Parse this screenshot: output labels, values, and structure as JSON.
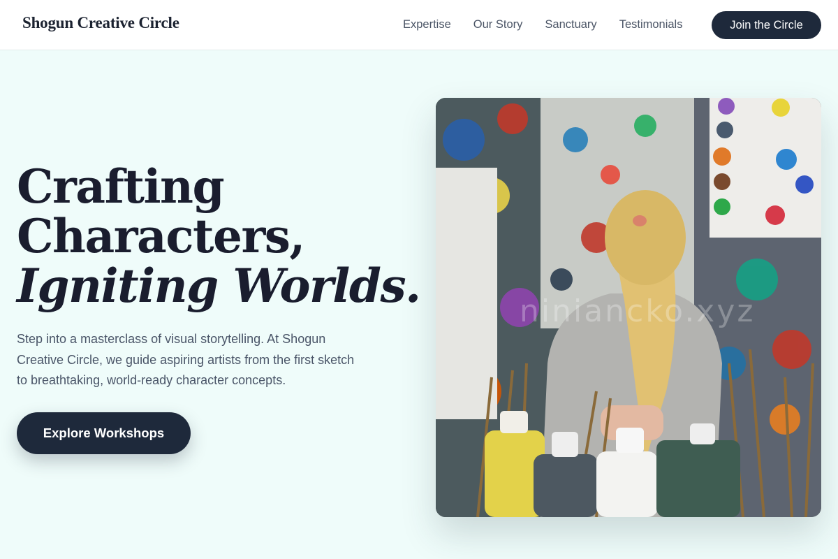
{
  "header": {
    "brand": "Shogun Creative Circle",
    "nav": [
      "Expertise",
      "Our Story",
      "Sanctuary",
      "Testimonials"
    ],
    "join_label": "Join the Circle"
  },
  "hero": {
    "title_line1": "Crafting",
    "title_line2": "Characters,",
    "title_line3": "Igniting Worlds.",
    "description": "Step into a masterclass of visual storytelling. At Shogun Creative Circle, we guide aspiring artists from the first sketch to breathtaking, world-ready character concepts.",
    "cta_label": "Explore Workshops"
  },
  "image": {
    "watermark": "niniancko.xyz",
    "alt": "child-painting-studio-photo"
  },
  "colors": {
    "background": "#effcfa",
    "primary": "#1e293b",
    "heading": "#1a1d2e",
    "body_text": "#4a5568"
  }
}
